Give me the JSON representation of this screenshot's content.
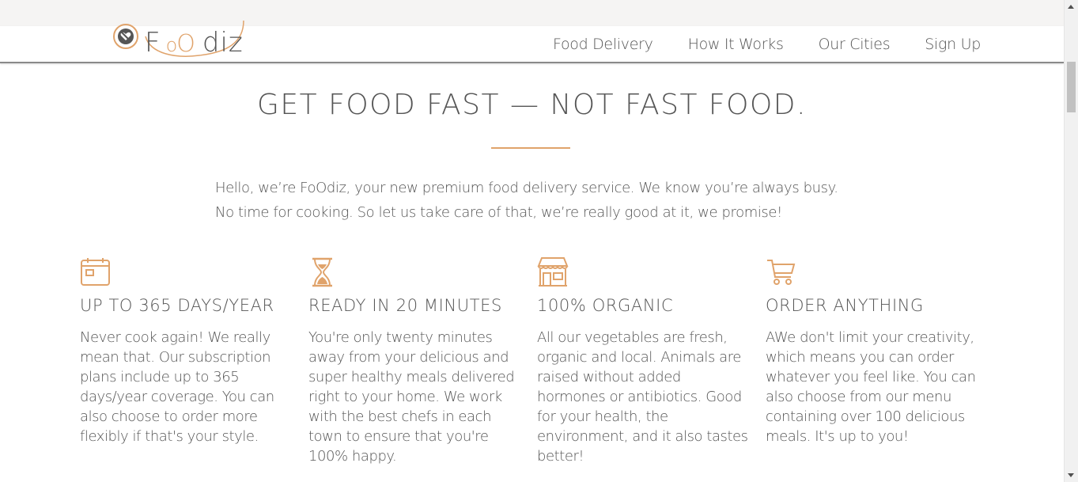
{
  "brand": {
    "logo_letters": [
      "F",
      "o",
      "O",
      "diz"
    ],
    "accent_color": "#e0a36b",
    "text_color": "#555555"
  },
  "nav": {
    "items": [
      {
        "label": "Food Delivery"
      },
      {
        "label": "How It Works"
      },
      {
        "label": "Our Cities"
      },
      {
        "label": "Sign Up"
      }
    ]
  },
  "section": {
    "title": "GET FOOD FAST — NOT FAST FOOD.",
    "intro": "Hello, we’re FoOdiz, your new premium food delivery service. We know you’re always busy. No time for cooking. So let us take care of that, we’re really good at it, we promise!"
  },
  "features": [
    {
      "icon": "calendar-icon",
      "title": "UP TO 365 DAYS/YEAR",
      "text": "Never cook again! We really mean that. Our subscription plans include up to 365 days/year coverage. You can also choose to order more flexibly if that's your style."
    },
    {
      "icon": "hourglass-icon",
      "title": "READY IN 20 MINUTES",
      "text": "You're only twenty minutes away from your delicious and super healthy meals delivered right to your home. We work with the best chefs in each town to ensure that you're 100% happy."
    },
    {
      "icon": "storefront-icon",
      "title": "100% ORGANIC",
      "text": "All our vegetables are fresh, organic and local. Animals are raised without added hormones or antibiotics. Good for your health, the environment, and it also tastes better!"
    },
    {
      "icon": "shopping-cart-icon",
      "title": "ORDER ANYTHING",
      "text": "AWe don't limit your creativity, which means you can order whatever you feel like. You can also choose from our menu containing over 100 delicious meals. It's up to you!"
    }
  ],
  "scrollbar": {
    "scroll_position": 0.08
  }
}
